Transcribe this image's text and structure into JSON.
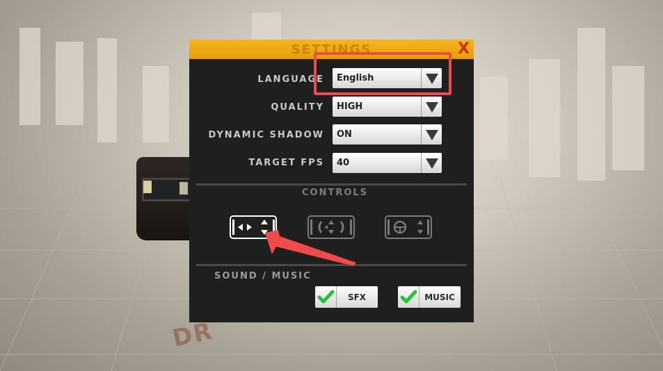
{
  "scene": {
    "ground_text": "DR",
    "accent_color": "#f04a4a"
  },
  "settings": {
    "title": "SETTINGS",
    "close_label": "X",
    "language": {
      "label": "LANGUAGE",
      "value": "English"
    },
    "quality": {
      "label": "QUALITY",
      "value": "HIGH"
    },
    "dynamic_shadow": {
      "label": "DYNAMIC SHADOW",
      "value": "ON"
    },
    "target_fps": {
      "label": "TARGET FPS",
      "value": "40"
    },
    "controls": {
      "label": "CONTROLS",
      "options": [
        {
          "icon": "arrows-control-icon",
          "selected": true
        },
        {
          "icon": "tilt-control-icon",
          "selected": false
        },
        {
          "icon": "steering-wheel-control-icon",
          "selected": false
        }
      ]
    },
    "sound_music": {
      "label": "SOUND / MUSIC",
      "sfx": {
        "label": "SFX",
        "checked": true
      },
      "music": {
        "label": "MUSIC",
        "checked": true
      }
    }
  }
}
